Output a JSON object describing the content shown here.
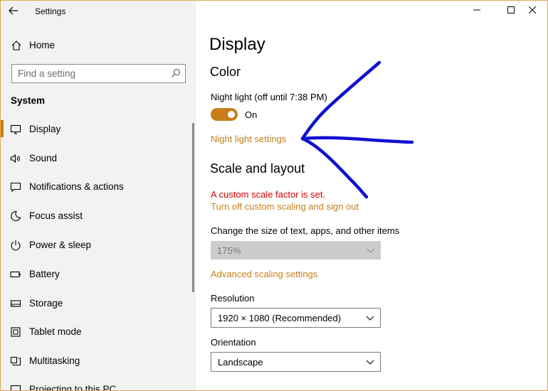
{
  "window": {
    "title": "Settings"
  },
  "sidebar": {
    "home_label": "Home",
    "search_placeholder": "Find a setting",
    "section_title": "System",
    "items": [
      {
        "label": "Display",
        "icon": "monitor-icon"
      },
      {
        "label": "Sound",
        "icon": "speaker-icon"
      },
      {
        "label": "Notifications & actions",
        "icon": "notification-icon"
      },
      {
        "label": "Focus assist",
        "icon": "moon-icon"
      },
      {
        "label": "Power & sleep",
        "icon": "power-icon"
      },
      {
        "label": "Battery",
        "icon": "battery-icon"
      },
      {
        "label": "Storage",
        "icon": "storage-icon"
      },
      {
        "label": "Tablet mode",
        "icon": "tablet-icon"
      },
      {
        "label": "Multitasking",
        "icon": "multitasking-icon"
      },
      {
        "label": "Projecting to this PC",
        "icon": "projecting-icon"
      }
    ],
    "active_item": "Display"
  },
  "main": {
    "page_title": "Display",
    "color_heading": "Color",
    "night_light_label": "Night light (off until 7:38 PM)",
    "night_light_toggle_text": "On",
    "night_light_toggle_on": true,
    "night_light_settings_link": "Night light settings",
    "scale_heading": "Scale and layout",
    "custom_scale_warning": "A custom scale factor is set.",
    "turn_off_scaling_link": "Turn off custom scaling and sign out",
    "size_label": "Change the size of text, apps, and other items",
    "size_value": "175%",
    "advanced_scaling_link": "Advanced scaling settings",
    "resolution_label": "Resolution",
    "resolution_value": "1920 × 1080 (Recommended)",
    "orientation_label": "Orientation",
    "orientation_value": "Landscape"
  },
  "colors": {
    "accent": "#c67f1b",
    "warning": "#d20000",
    "annotation_arrow": "#1010d0",
    "sidebar_bg": "#f2f2f2"
  }
}
